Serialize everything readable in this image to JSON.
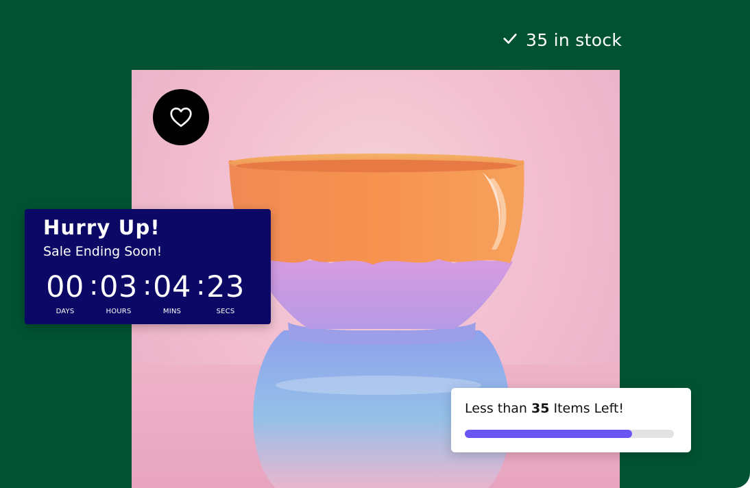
{
  "stock": {
    "icon": "check-icon",
    "text": "35 in stock"
  },
  "product": {
    "favorite_icon": "heart-icon"
  },
  "countdown": {
    "title": "Hurry Up!",
    "subtitle": "Sale Ending Soon!",
    "units": [
      {
        "value": "00",
        "label": "DAYS"
      },
      {
        "value": "03",
        "label": "HOURS"
      },
      {
        "value": "04",
        "label": "MINS"
      },
      {
        "value": "23",
        "label": "SECS"
      }
    ],
    "separator": ":"
  },
  "inventory": {
    "prefix": "Less than ",
    "count": "35",
    "suffix": " Items Left!",
    "progress": 0.8
  },
  "colors": {
    "background": "#005233",
    "countdown_bg": "#0b0866",
    "progress_fill": "#6a55f5",
    "progress_track": "#e3e3e3"
  }
}
